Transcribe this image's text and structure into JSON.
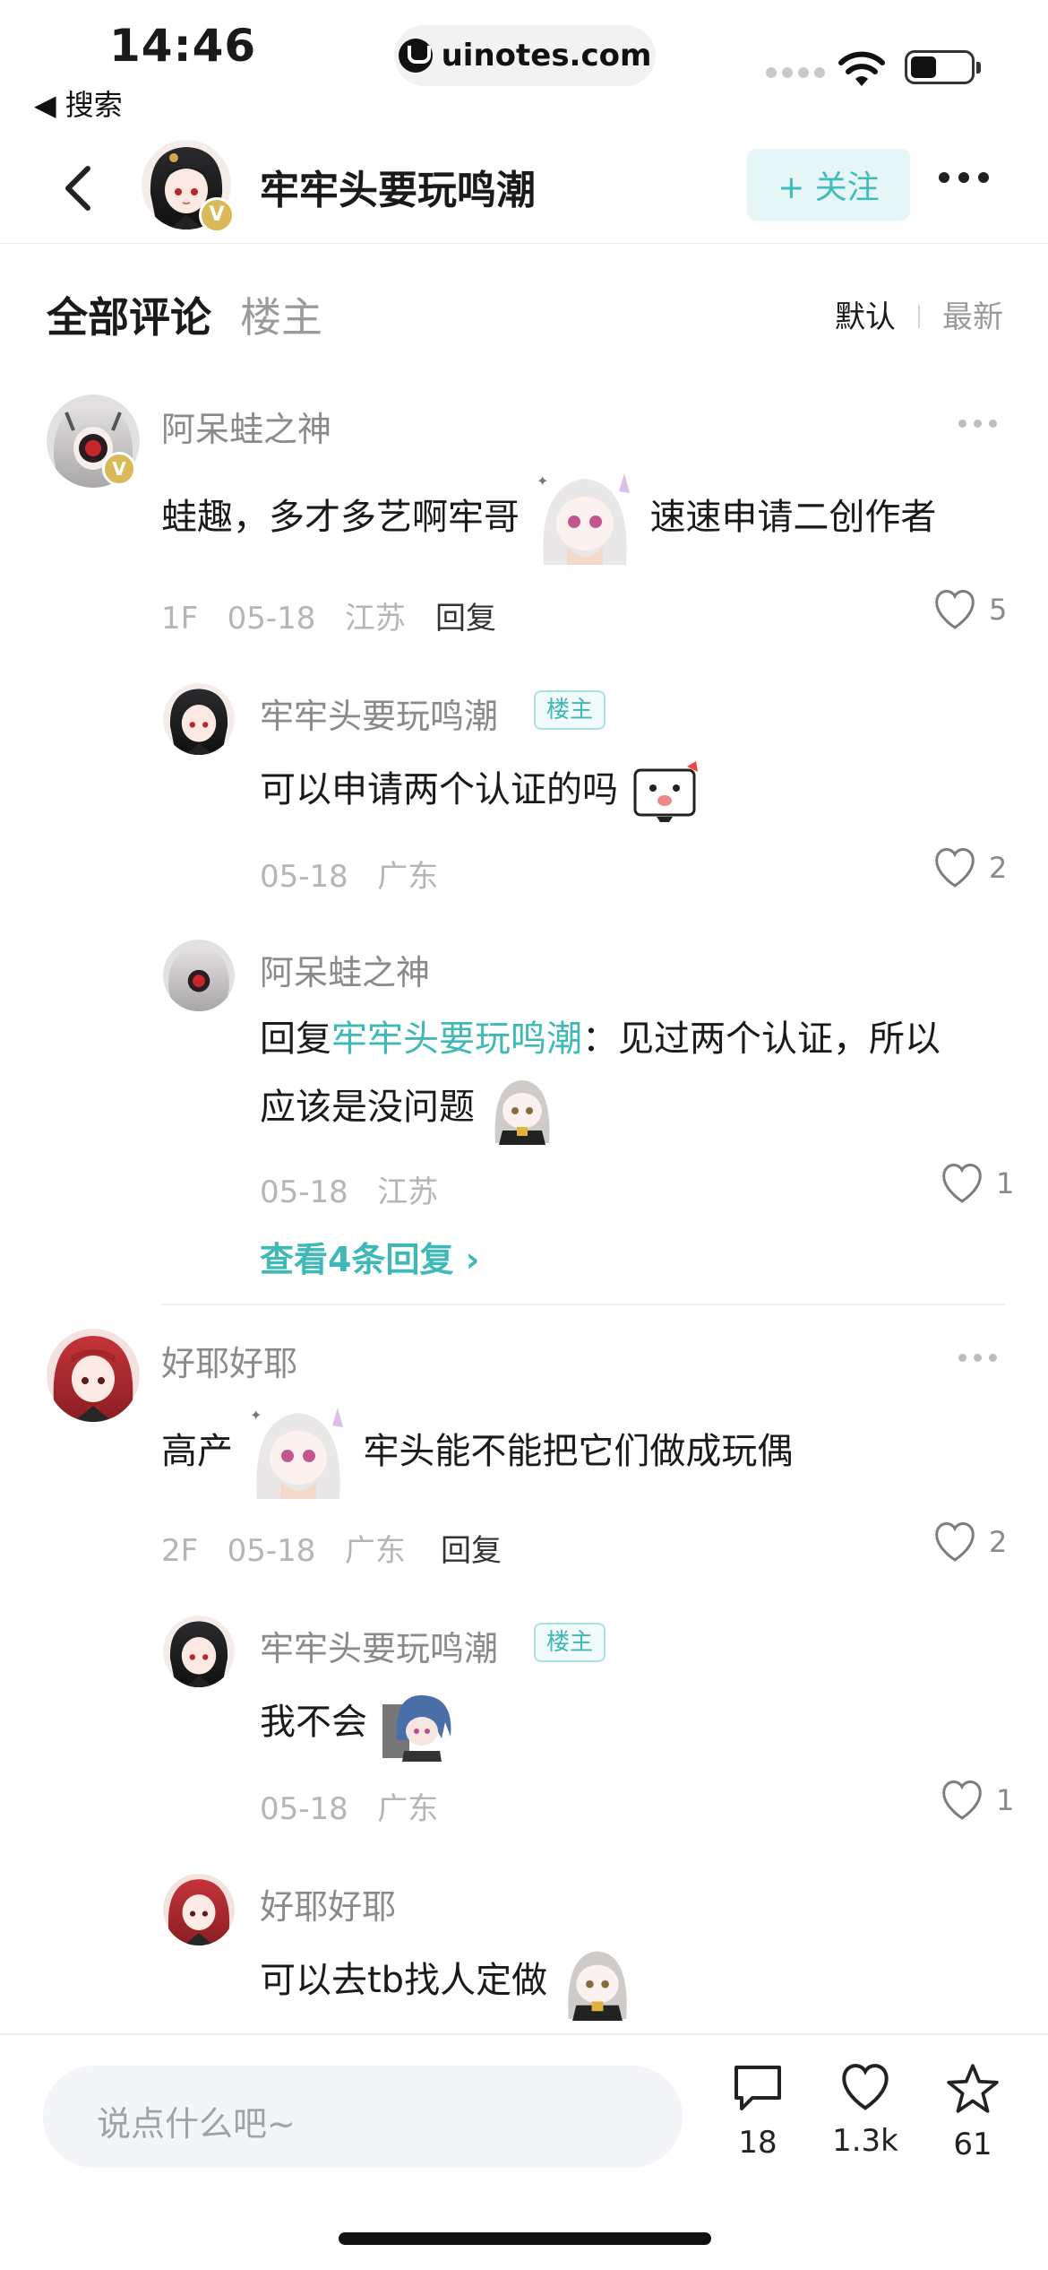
{
  "status": {
    "time": "14:46",
    "back_app": "◀ 搜索",
    "url": "uinotes.com"
  },
  "header": {
    "title": "牢牢头要玩鸣潮",
    "follow_label": "+ 关注",
    "verified_badge": "V"
  },
  "tabs": {
    "all": "全部评论",
    "op": "楼主",
    "sort_default": "默认",
    "sort_newest": "最新"
  },
  "comments": [
    {
      "name": "阿呆蛙之神",
      "text_before": "蛙趣，多才多艺啊牢哥",
      "text_after": "速速申请二创作者",
      "floor": "1F",
      "date": "05-18",
      "location": "江苏",
      "reply_label": "回复",
      "likes": "5",
      "replies": [
        {
          "name": "牢牢头要玩鸣潮",
          "tag": "楼主",
          "text": "可以申请两个认证的吗",
          "date": "05-18",
          "location": "广东",
          "likes": "2"
        },
        {
          "name": "阿呆蛙之神",
          "reply_prefix": "回复",
          "reply_to": "牢牢头要玩鸣潮",
          "text_line1": "：见过两个认证，所以",
          "text_line2": "应该是没问题",
          "date": "05-18",
          "location": "江苏",
          "likes": "1"
        }
      ],
      "view_more": "查看4条回复 ›"
    },
    {
      "name": "好耶好耶",
      "text_before": "高产",
      "text_after": "牢头能不能把它们做成玩偶",
      "floor": "2F",
      "date": "05-18",
      "location": "广东",
      "reply_label": "回复",
      "likes": "2",
      "replies": [
        {
          "name": "牢牢头要玩鸣潮",
          "tag": "楼主",
          "text": "我不会",
          "date": "05-18",
          "location": "广东",
          "likes": "1"
        },
        {
          "name": "好耶好耶",
          "text": "可以去tb找人定做"
        }
      ]
    }
  ],
  "bottom": {
    "input_placeholder": "说点什么吧~",
    "comments_count": "18",
    "likes_count": "1.3k",
    "favorites_count": "61"
  },
  "colors": {
    "accent": "#3fb8b8",
    "verified": "#d9b959",
    "muted": "#8a8a8a"
  },
  "icons": [
    "back-icon",
    "more-icon",
    "heart-icon",
    "comment-icon",
    "star-icon",
    "wifi-icon",
    "battery-icon"
  ]
}
